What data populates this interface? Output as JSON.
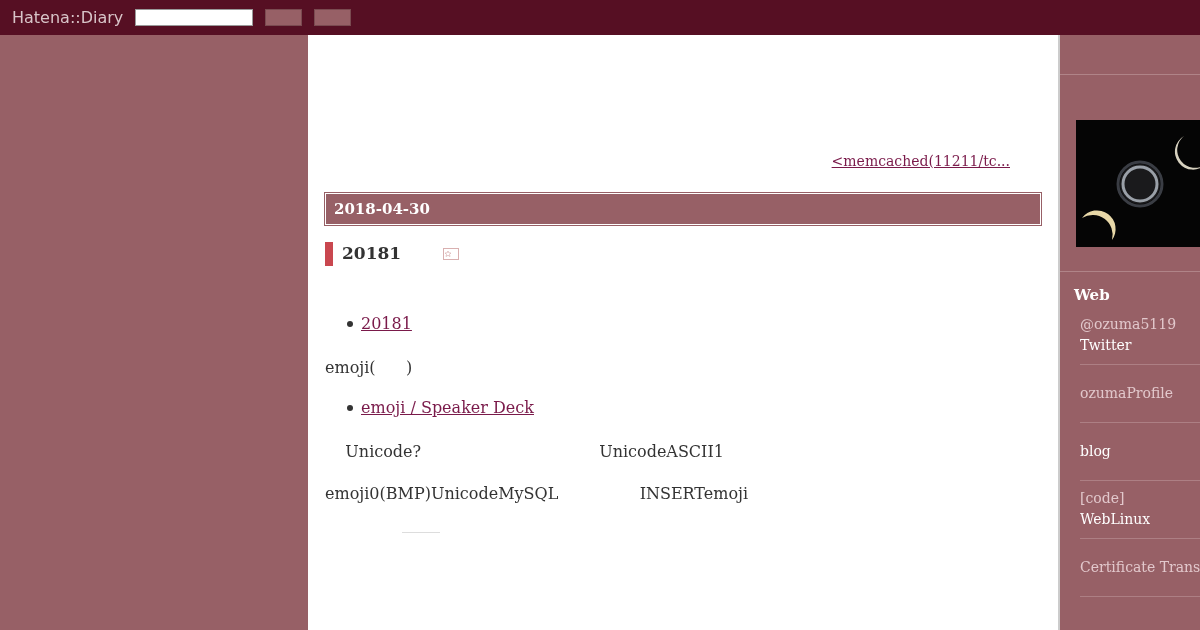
{
  "header": {
    "logo": "Hatena::Diary"
  },
  "nav": {
    "prev_link": "<memcached(11211/tc..."
  },
  "day": {
    "date": "2018-04-30"
  },
  "section": {
    "title": "20181"
  },
  "body": [
    {
      "kind": "link",
      "text": "20181"
    },
    {
      "kind": "para",
      "text": "emoji(      )"
    },
    {
      "kind": "link",
      "text": "emoji / Speaker Deck"
    },
    {
      "kind": "para",
      "text": "    Unicode?                                   UnicodeASCII1"
    },
    {
      "kind": "para",
      "text": "emoji0(BMP)UnicodeMySQL                INSERTemoji"
    }
  ],
  "sidebar": {
    "heading": "Web",
    "items": [
      {
        "link": "@ozuma5119",
        "text": "Twitter"
      },
      {
        "link": "ozumaProfile"
      },
      {
        "text": "blog"
      },
      {
        "link": "[code]",
        "text": "WebLinux"
      },
      {
        "link": "Certificate Trans"
      }
    ]
  }
}
